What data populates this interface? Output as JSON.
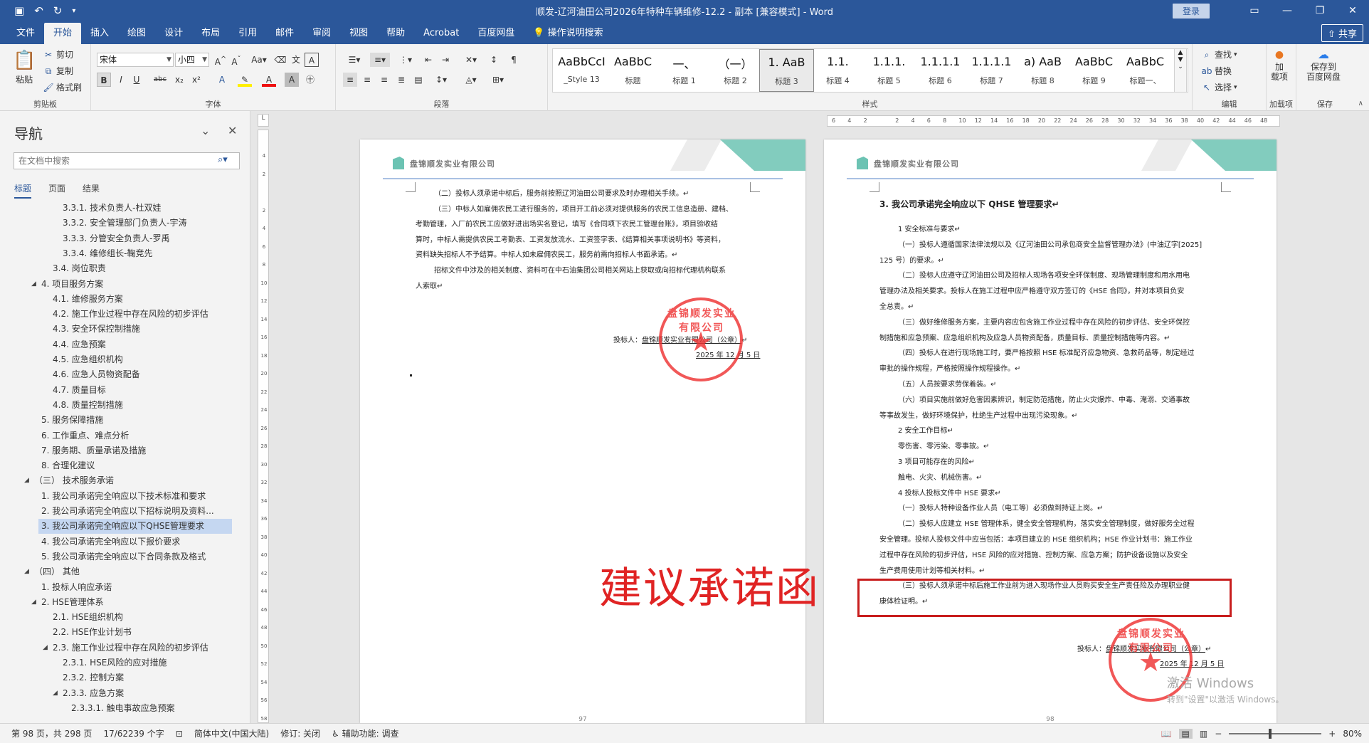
{
  "titlebar": {
    "title": "顺发-辽河油田公司2026年特种车辆维修-12.2 - 副本 [兼容模式] - Word",
    "login": "登录",
    "qat_icons": [
      "save-icon",
      "undo-icon",
      "redo-icon"
    ]
  },
  "tabs": [
    "文件",
    "开始",
    "插入",
    "绘图",
    "设计",
    "布局",
    "引用",
    "邮件",
    "审阅",
    "视图",
    "帮助",
    "Acrobat",
    "百度网盘",
    "操作说明搜索"
  ],
  "share": "共享",
  "ribbon": {
    "clipboard": {
      "paste": "粘贴",
      "cut": "剪切",
      "copy": "复制",
      "format_painter": "格式刷",
      "label": "剪贴板"
    },
    "font": {
      "name": "宋体",
      "size": "小四",
      "label": "字体",
      "buttons": [
        "B",
        "I",
        "U",
        "abc",
        "x₂",
        "x²"
      ]
    },
    "paragraph": {
      "label": "段落"
    },
    "styles": {
      "label": "样式",
      "items": [
        {
          "preview": "AaBbCcI",
          "name": "_Style 13"
        },
        {
          "preview": "AaBbC",
          "name": "标题"
        },
        {
          "preview": "一、",
          "name": "标题 1"
        },
        {
          "preview": "（一）",
          "name": "标题 2"
        },
        {
          "preview": "1. AaB",
          "name": "标题 3"
        },
        {
          "preview": "1.1.",
          "name": "标题 4"
        },
        {
          "preview": "1.1.1.",
          "name": "标题 5"
        },
        {
          "preview": "1.1.1.1",
          "name": "标题 6"
        },
        {
          "preview": "1.1.1.1",
          "name": "标题 7"
        },
        {
          "preview": "a) AaB",
          "name": "标题 8"
        },
        {
          "preview": "AaBbC",
          "name": "标题 9"
        },
        {
          "preview": "AaBbC",
          "name": "标题一、"
        }
      ]
    },
    "editing": {
      "find": "查找",
      "replace": "替换",
      "select": "选择",
      "label": "编辑"
    },
    "addins": {
      "btn": "加\n载项",
      "label": "加载项"
    },
    "save": {
      "btn": "保存到\n百度网盘",
      "label": "保存"
    }
  },
  "nav": {
    "title": "导航",
    "search_placeholder": "在文档中搜索",
    "tabs": [
      "标题",
      "页面",
      "结果"
    ],
    "items": [
      {
        "text": "3.3.1. 技术负责人-杜双娃",
        "level": 4
      },
      {
        "text": "3.3.2. 安全管理部门负责人-宇涛",
        "level": 4
      },
      {
        "text": "3.3.3. 分管安全负责人-罗禹",
        "level": 4
      },
      {
        "text": "3.3.4. 维修组长-鞠竞先",
        "level": 4
      },
      {
        "text": "3.4. 岗位职责",
        "level": 3
      },
      {
        "text": "4. 项目服务方案",
        "level": 2,
        "expanded": true
      },
      {
        "text": "4.1. 维修服务方案",
        "level": 3
      },
      {
        "text": "4.2. 施工作业过程中存在风险的初步评估",
        "level": 3
      },
      {
        "text": "4.3. 安全环保控制措施",
        "level": 3
      },
      {
        "text": "4.4. 应急预案",
        "level": 3
      },
      {
        "text": "4.5. 应急组织机构",
        "level": 3
      },
      {
        "text": "4.6. 应急人员物资配备",
        "level": 3
      },
      {
        "text": "4.7. 质量目标",
        "level": 3
      },
      {
        "text": "4.8. 质量控制措施",
        "level": 3
      },
      {
        "text": "5. 服务保障措施",
        "level": 2
      },
      {
        "text": "6. 工作重点、难点分析",
        "level": 2
      },
      {
        "text": "7. 服务期、质量承诺及措施",
        "level": 2
      },
      {
        "text": "8. 合理化建议",
        "level": 2
      },
      {
        "text": "（三） 技术服务承诺",
        "level": 1,
        "expanded": true
      },
      {
        "text": "1. 我公司承诺完全响应以下技术标准和要求",
        "level": 2
      },
      {
        "text": "2. 我公司承诺完全响应以下招标说明及资料...",
        "level": 2
      },
      {
        "text": "3. 我公司承诺完全响应以下QHSE管理要求",
        "level": 2,
        "selected": true
      },
      {
        "text": "4. 我公司承诺完全响应以下报价要求",
        "level": 2
      },
      {
        "text": "5. 我公司承诺完全响应以下合同条款及格式",
        "level": 2
      },
      {
        "text": "（四） 其他",
        "level": 1,
        "expanded": true
      },
      {
        "text": "1. 投标人响应承诺",
        "level": 2
      },
      {
        "text": "2. HSE管理体系",
        "level": 2,
        "expanded": true
      },
      {
        "text": "2.1. HSE组织机构",
        "level": 3
      },
      {
        "text": "2.2. HSE作业计划书",
        "level": 3
      },
      {
        "text": "2.3. 施工作业过程中存在风险的初步评估",
        "level": 3,
        "expanded": true
      },
      {
        "text": "2.3.1. HSE风险的应对措施",
        "level": 4
      },
      {
        "text": "2.3.2. 控制方案",
        "level": 4
      },
      {
        "text": "2.3.3. 应急方案",
        "level": 4,
        "expanded": true
      },
      {
        "text": "2.3.3.1. 触电事故应急预案",
        "level": 5
      }
    ]
  },
  "hruler": [
    "6",
    "4",
    "2",
    "",
    "2",
    "4",
    "6",
    "8",
    "10",
    "12",
    "14",
    "16",
    "18",
    "20",
    "22",
    "24",
    "26",
    "28",
    "30",
    "32",
    "34",
    "36",
    "38",
    "40",
    "42",
    "44",
    "46",
    "48"
  ],
  "vruler": [
    "4",
    "2",
    "",
    "2",
    "4",
    "6",
    "8",
    "10",
    "12",
    "14",
    "16",
    "18",
    "20",
    "22",
    "24",
    "26",
    "28",
    "30",
    "32",
    "34",
    "36",
    "38",
    "40",
    "42",
    "44",
    "46",
    "48",
    "50",
    "52",
    "54",
    "56",
    "58"
  ],
  "page_left": {
    "company": "盘锦顺发实业有限公司",
    "lines": [
      "（二）投标人须承诺中标后，服务前按照辽河油田公司要求及时办理相关手续。↵",
      "（三）中标人如雇佣农民工进行服务的，项目开工前必须对提供服务的农民工信息造册、建档、",
      "考勤管理，入厂前农民工应做好进出场实名登记，填写《合同项下农民工管理台账》，项目验收结",
      "算时，中标人需提供农民工考勤表、工资发放流水、工资签字表、《结算相关事项说明书》等资料，",
      "资料缺失招标人不予结算。中标人如未雇佣农民工，服务前需向招标人书面承诺。↵",
      "招标文件中涉及的相关制度、资料可在中石油集团公司相关网站上获取或向招标代理机构联系",
      "人索取↵"
    ],
    "signer_label": "投标人：",
    "signer": "盘锦顺发实业有限公司（公章）",
    "date": "2025 年 12 月 5 日",
    "page_num": "97"
  },
  "page_right": {
    "company": "盘锦顺发实业有限公司",
    "heading": "3. 我公司承诺完全响应以下 QHSE 管理要求↵",
    "lines": [
      "1 安全标准与要求↵",
      "（一）投标人遵循国家法律法规以及《辽河油田公司承包商安全监督管理办法》(中油辽字[2025]",
      "125 号）的要求。↵",
      "（二）投标人应遵守辽河油田公司及招标人现场各项安全环保制度、现场管理制度和用水用电",
      "管理办法及相关要求。投标人在施工过程中应严格遵守双方签订的《HSE 合同》，并对本项目负安",
      "全总责。↵",
      "（三）做好维修服务方案，主要内容应包含施工作业过程中存在风险的初步评估、安全环保控",
      "制措施和应急预案、应急组织机构及应急人员物资配备，质量目标、质量控制措施等内容。↵",
      "（四）投标人在进行现场施工时，要严格按照 HSE 标准配齐应急物资、急救药品等，制定经过",
      "审批的操作规程，严格按照操作规程操作。↵",
      "（五）人员按要求劳保着装。↵",
      "（六）项目实施前做好危害因素辨识，制定防范措施，防止火灾爆炸、中毒、淹溺、交通事故",
      "等事故发生，做好环境保护，杜绝生产过程中出现污染现象。↵",
      "2 安全工作目标↵",
      "零伤害、零污染、零事故。↵",
      "3 项目可能存在的风险↵",
      "触电、火灾、机械伤害。↵",
      "4 投标人投标文件中 HSE 要求↵",
      "（一）投标人特种设备作业人员（电工等）必须做到持证上岗。↵",
      "（二）投标人应建立 HSE 管理体系，健全安全管理机构，落实安全管理制度，做好服务全过程",
      "安全管理。投标人投标文件中应当包括：本项目建立的 HSE 组织机构；HSE 作业计划书：施工作业",
      "过程中存在风险的初步评估，HSE 风险的应对措施、控制方案、应急方案；防护设备设施以及安全",
      "生产费用使用计划等相关材料。↵",
      "（三）投标人须承诺中标后施工作业前为进入现场作业人员购买安全生产责任险及办理职业健",
      "康体检证明。↵"
    ],
    "signer_label": "投标人：",
    "signer": "盘锦顺发实业有限公司（公章）",
    "date": "2025 年 12 月 5 日",
    "page_num": "98"
  },
  "stamp_text": "盘锦顺发实业有限公司",
  "annotation": "建议承诺函",
  "watermark": {
    "line1": "激活 Windows",
    "line2": "转到\"设置\"以激活 Windows。"
  },
  "statusbar": {
    "page": "第 98 页，共 298 页",
    "words": "17/62239 个字",
    "language": "简体中文(中国大陆)",
    "track": "修订: 关闭",
    "accessibility": "辅助功能: 调查",
    "zoom": "80%"
  },
  "colors": {
    "accent": "#2b579a",
    "header_band": "#6cc3b3",
    "annotation_red": "#e02424",
    "stamp_red": "#e33333"
  }
}
